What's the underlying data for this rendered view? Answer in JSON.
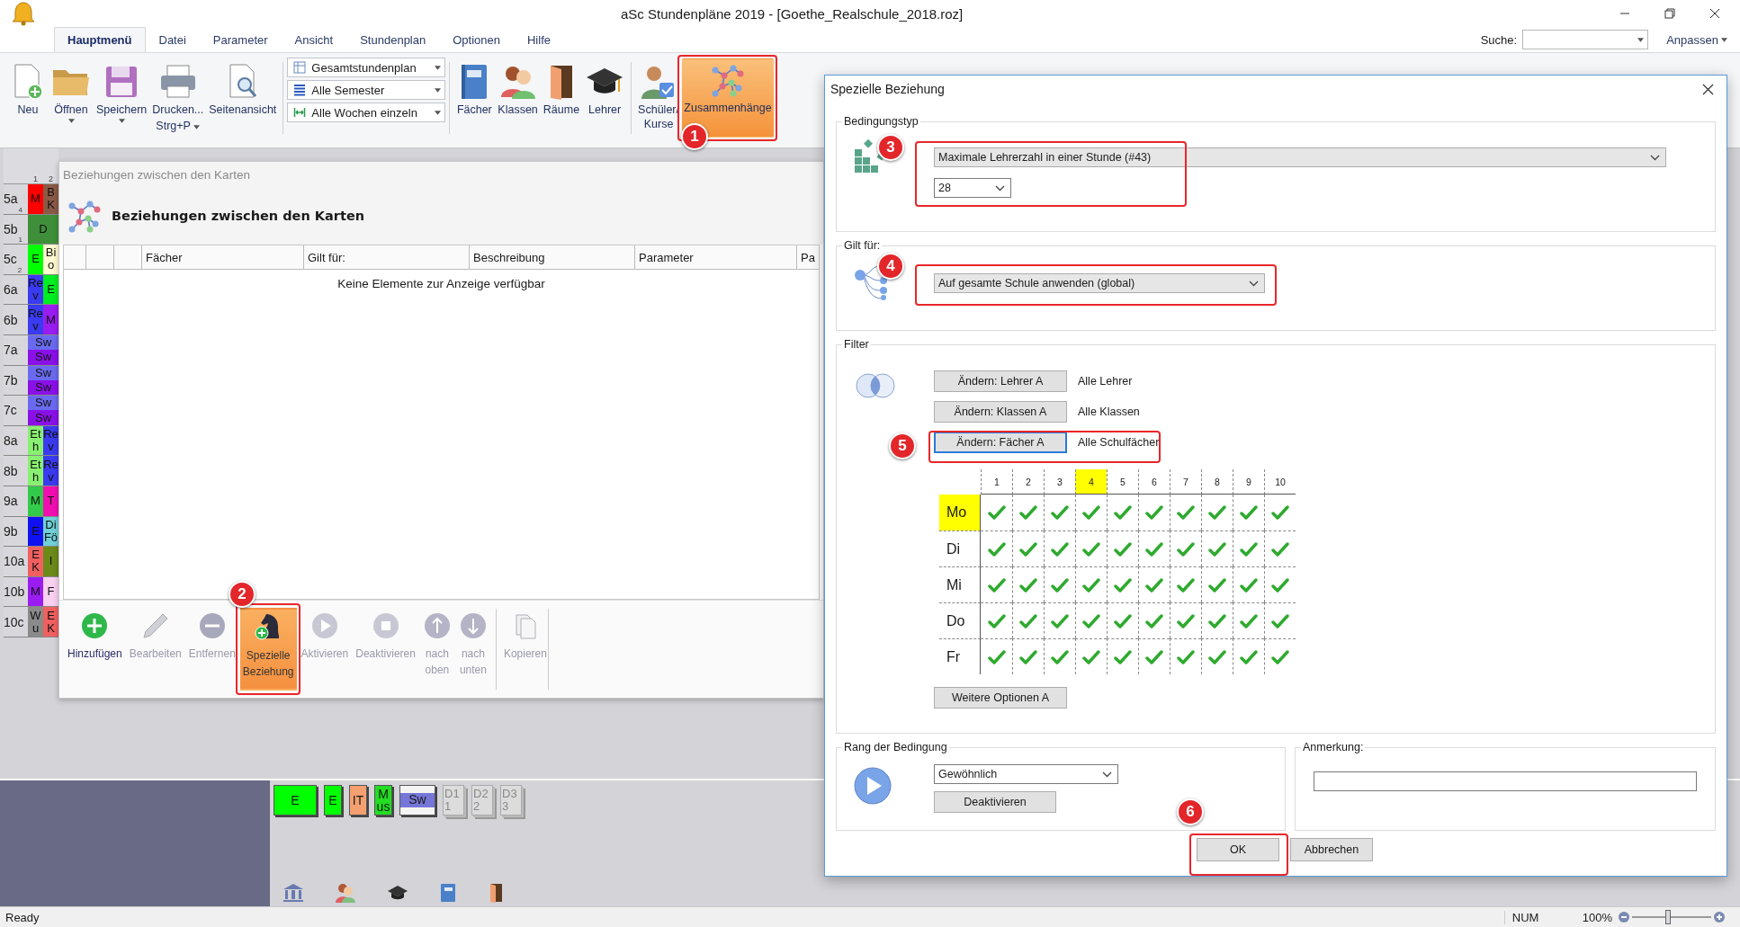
{
  "window": {
    "title": "aSc Stundenpläne 2019  - [Goethe_Realschule_2018.roz]"
  },
  "ribbon_tabs": [
    {
      "label": "Hauptmenü",
      "selected": true
    },
    {
      "label": "Datei",
      "selected": false
    },
    {
      "label": "Parameter",
      "selected": false
    },
    {
      "label": "Ansicht",
      "selected": false
    },
    {
      "label": "Stundenplan",
      "selected": false
    },
    {
      "label": "Optionen",
      "selected": false
    },
    {
      "label": "Hilfe",
      "selected": false
    }
  ],
  "search": {
    "label": "Suche:"
  },
  "customize": {
    "label": "Anpassen"
  },
  "ribbon": {
    "file_buttons": [
      {
        "label": "Neu",
        "kind": "new",
        "dropdown": false
      },
      {
        "label": "Öffnen",
        "kind": "open",
        "dropdown": true
      },
      {
        "label": "Speichern",
        "kind": "save",
        "dropdown": true
      },
      {
        "label": "Drucken...",
        "shortcut": "Strg+P",
        "kind": "print",
        "dropdown": true
      },
      {
        "label": "Seitenansicht",
        "kind": "preview",
        "dropdown": false
      }
    ],
    "view_selects": [
      {
        "label": "Gesamtstundenplan",
        "kind": "table"
      },
      {
        "label": "Alle Semester",
        "kind": "lines"
      },
      {
        "label": "Alle Wochen einzeln",
        "kind": "weeks"
      }
    ],
    "data_buttons": [
      {
        "label": "Fächer",
        "kind": "book",
        "selected": false
      },
      {
        "label": "Klassen",
        "kind": "people",
        "selected": false
      },
      {
        "label": "Räume",
        "kind": "door",
        "selected": false
      },
      {
        "label": "Lehrer",
        "kind": "cap",
        "selected": false
      },
      {
        "label": "Schüler/ Kurse",
        "kind": "student",
        "selected": false
      },
      {
        "label": "Zusammenhänge",
        "kind": "network",
        "selected": true
      }
    ]
  },
  "timetable": {
    "columns": [
      "1",
      "2"
    ],
    "classes": [
      {
        "name": "5a",
        "count": "4",
        "kind": "columns",
        "lessons": [
          {
            "text": "M",
            "color": "#ff0000"
          },
          {
            "text": "BK",
            "color": "#8b5a45"
          }
        ]
      },
      {
        "name": "5b",
        "count": "1",
        "kind": "columns",
        "lessons": [
          {
            "text": "D",
            "color": "#3f8f3a"
          }
        ]
      },
      {
        "name": "5c",
        "count": "2",
        "kind": "columns",
        "lessons": [
          {
            "text": "E",
            "color": "#00ff00"
          },
          {
            "text": "Bio",
            "color": "#fffad0"
          }
        ]
      },
      {
        "name": "6a",
        "kind": "columns",
        "lessons": [
          {
            "text": "Rev",
            "color": "#3a3af0"
          },
          {
            "text": "E",
            "color": "#00ee22"
          }
        ]
      },
      {
        "name": "6b",
        "kind": "columns",
        "lessons": [
          {
            "text": "Rev",
            "color": "#3a3af0"
          },
          {
            "text": "M",
            "color": "#9a1cf0"
          }
        ]
      },
      {
        "name": "7a",
        "kind": "stacked",
        "lessons": [
          {
            "text": "Sw",
            "color": "#6a6af0"
          },
          {
            "text": "Sw",
            "color": "#8a10e8"
          }
        ]
      },
      {
        "name": "7b",
        "kind": "stacked",
        "lessons": [
          {
            "text": "Sw",
            "color": "#6a6af0"
          },
          {
            "text": "Sw",
            "color": "#8a10e8"
          }
        ]
      },
      {
        "name": "7c",
        "kind": "stacked",
        "lessons": [
          {
            "text": "Sw",
            "color": "#6a6af0"
          },
          {
            "text": "Sw",
            "color": "#8a10e8"
          }
        ]
      },
      {
        "name": "8a",
        "kind": "columns",
        "lessons": [
          {
            "text": "Eth",
            "color": "#88f070"
          },
          {
            "text": "Rev",
            "color": "#3a3af0"
          }
        ]
      },
      {
        "name": "8b",
        "kind": "columns",
        "lessons": [
          {
            "text": "Eth",
            "color": "#88f070"
          },
          {
            "text": "Rev",
            "color": "#3a3af0"
          }
        ]
      },
      {
        "name": "9a",
        "kind": "columns",
        "lessons": [
          {
            "text": "M",
            "color": "#33c94a"
          },
          {
            "text": "T",
            "color": "#f010b0"
          }
        ]
      },
      {
        "name": "9b",
        "kind": "columns",
        "lessons": [
          {
            "text": "E",
            "color": "#1010f0"
          },
          {
            "text": "DiFö",
            "color": "#70d0d8"
          }
        ]
      },
      {
        "name": "10a",
        "kind": "columns",
        "lessons": [
          {
            "text": "EK",
            "color": "#f06060"
          },
          {
            "text": "I",
            "color": "#6b8a1a"
          }
        ]
      },
      {
        "name": "10b",
        "kind": "columns",
        "lessons": [
          {
            "text": "M",
            "color": "#9a1cf0"
          },
          {
            "text": "F",
            "color": "#f8d0f0"
          }
        ]
      },
      {
        "name": "10c",
        "kind": "columns",
        "lessons": [
          {
            "text": "Wu",
            "color": "#8a8a8a"
          },
          {
            "text": "EK",
            "color": "#f06060"
          }
        ]
      }
    ]
  },
  "relations_window": {
    "title": "Beziehungen zwischen den Karten",
    "heading": "Beziehungen zwischen den Karten",
    "columns": [
      "Fächer",
      "Gilt für:",
      "Beschreibung",
      "Parameter",
      "Pa"
    ],
    "empty_message": "Keine Elemente zur Anzeige verfügbar",
    "toolbar": [
      {
        "label": "Hinzufügen",
        "kind": "add",
        "disabled": false,
        "selected": false
      },
      {
        "label": "Bearbeiten",
        "kind": "edit",
        "disabled": true,
        "selected": false
      },
      {
        "label": "Entfernen",
        "kind": "remove",
        "disabled": true,
        "selected": false
      },
      {
        "label": "Spezielle Beziehung",
        "kind": "special",
        "disabled": false,
        "selected": true
      },
      {
        "label": "Aktivieren",
        "kind": "play",
        "disabled": true,
        "selected": false
      },
      {
        "label": "Deaktivieren",
        "kind": "stop",
        "disabled": true,
        "selected": false
      },
      {
        "label": "nach oben",
        "kind": "up",
        "disabled": true,
        "selected": false
      },
      {
        "label": "nach unten",
        "kind": "down",
        "disabled": true,
        "selected": false
      },
      {
        "label": "Kopieren",
        "kind": "copy",
        "disabled": true,
        "selected": false
      }
    ]
  },
  "dialog": {
    "title": "Spezielle Beziehung",
    "condition": {
      "legend": "Bedingungstyp",
      "type": "Maximale Lehrerzahl in einer Stunde (#43)",
      "value": "28"
    },
    "scope": {
      "legend": "Gilt für:",
      "value": "Auf gesamte Schule anwenden (global)"
    },
    "filter": {
      "legend": "Filter",
      "rows": [
        {
          "button": "Ändern: Lehrer A",
          "value": "Alle Lehrer",
          "focused": false
        },
        {
          "button": "Ändern: Klassen A",
          "value": "Alle Klassen",
          "focused": false
        },
        {
          "button": "Ändern: Fächer A",
          "value": "Alle Schulfächer",
          "focused": true
        }
      ],
      "periods": [
        {
          "label": "1",
          "selected": false
        },
        {
          "label": "2",
          "selected": false
        },
        {
          "label": "3",
          "selected": false
        },
        {
          "label": "4",
          "selected": true
        },
        {
          "label": "5",
          "selected": false
        },
        {
          "label": "6",
          "selected": false
        },
        {
          "label": "7",
          "selected": false
        },
        {
          "label": "8",
          "selected": false
        },
        {
          "label": "9",
          "selected": false
        },
        {
          "label": "10",
          "selected": false
        }
      ],
      "days": [
        {
          "label": "Mo",
          "selected": true,
          "slots": [
            true,
            true,
            true,
            true,
            true,
            true,
            true,
            true,
            true,
            true
          ]
        },
        {
          "label": "Di",
          "selected": false,
          "slots": [
            true,
            true,
            true,
            true,
            true,
            true,
            true,
            true,
            true,
            true
          ]
        },
        {
          "label": "Mi",
          "selected": false,
          "slots": [
            true,
            true,
            true,
            true,
            true,
            true,
            true,
            true,
            true,
            true
          ]
        },
        {
          "label": "Do",
          "selected": false,
          "slots": [
            true,
            true,
            true,
            true,
            true,
            true,
            true,
            true,
            true,
            true
          ]
        },
        {
          "label": "Fr",
          "selected": false,
          "slots": [
            true,
            true,
            true,
            true,
            true,
            true,
            true,
            true,
            true,
            true
          ]
        }
      ],
      "more_button": "Weitere Optionen A"
    },
    "rank": {
      "legend": "Rang der Bedingung",
      "value": "Gewöhnlich",
      "button": "Deaktivieren"
    },
    "note": {
      "legend": "Anmerkung:"
    },
    "buttons": [
      "OK",
      "Abbrechen"
    ]
  },
  "bottom_panel": {
    "cards": [
      {
        "text": "E",
        "color": "#00ff00",
        "kind": "lesson"
      },
      {
        "text": "E",
        "color": "#00ff00",
        "kind": "lesson"
      },
      {
        "text": "IT",
        "color": "#f4a070",
        "kind": "lesson"
      },
      {
        "text": "Mus",
        "color": "#22dd22",
        "kind": "lesson"
      },
      {
        "text": "Sw",
        "color": "#7676d8",
        "kind": "split"
      },
      {
        "text": "D1",
        "sub": "1",
        "color": "#dcdcdc",
        "kind": "stack"
      },
      {
        "text": "D2",
        "sub": "2",
        "color": "#dcdcdc",
        "kind": "stack"
      },
      {
        "text": "D3",
        "sub": "3",
        "color": "#dcdcdc",
        "kind": "stack"
      }
    ]
  },
  "annotations": [
    {
      "label": "1"
    },
    {
      "label": "2"
    },
    {
      "label": "3"
    },
    {
      "label": "4"
    },
    {
      "label": "5"
    },
    {
      "label": "6"
    }
  ],
  "status_bar": {
    "text": "Ready",
    "num": "NUM",
    "zoom": "100%",
    "zoom_slider": {
      "level": 0.45
    }
  }
}
